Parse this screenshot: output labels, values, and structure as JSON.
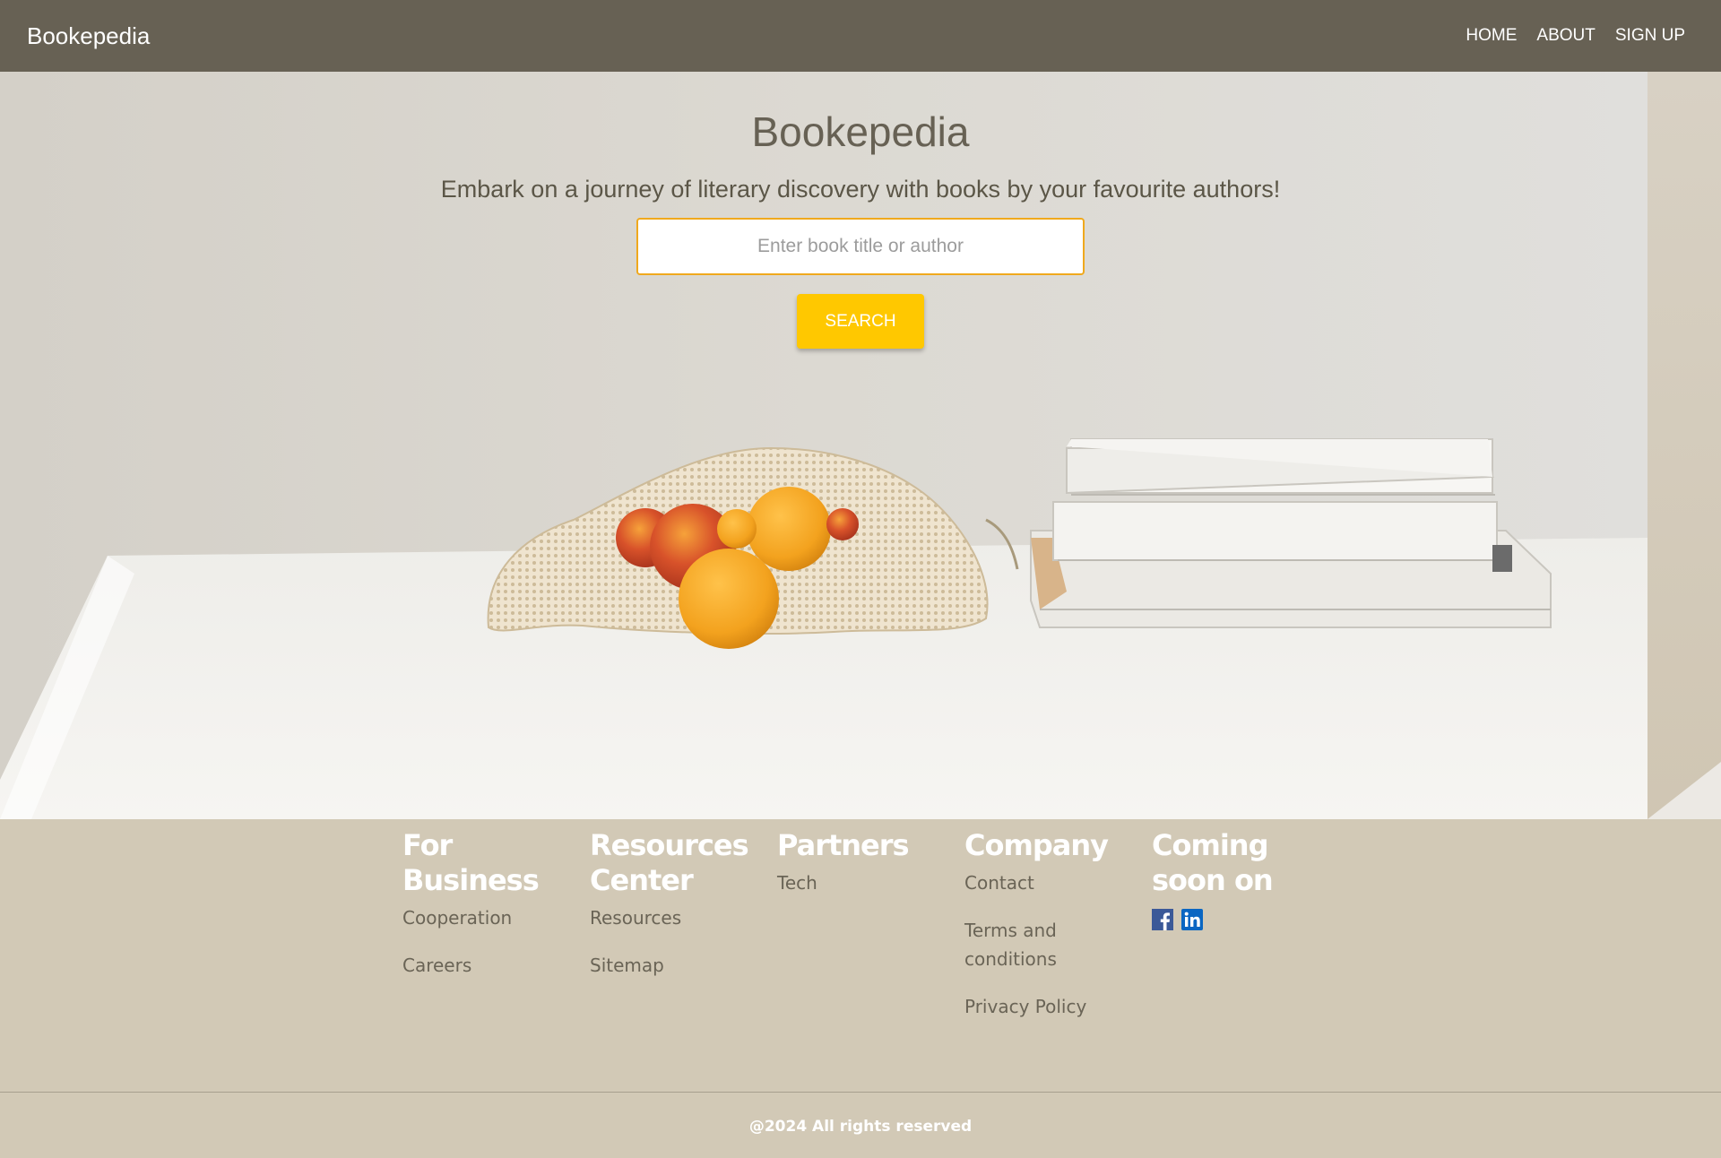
{
  "nav": {
    "brand": "Bookepedia",
    "links": [
      "HOME",
      "ABOUT",
      "SIGN UP"
    ]
  },
  "hero": {
    "title": "Bookepedia",
    "subtitle": "Embark on a journey of literary discovery with books by your favourite authors!",
    "search_placeholder": "Enter book title or author",
    "search_value": "",
    "search_button": "SEARCH"
  },
  "footer": {
    "columns": [
      {
        "heading": "For Business",
        "links": [
          "Cooperation",
          "Careers"
        ]
      },
      {
        "heading": "Resources Center",
        "links": [
          "Resources",
          "Sitemap"
        ]
      },
      {
        "heading": "Partners",
        "links": [
          "Tech"
        ]
      },
      {
        "heading": "Company",
        "links": [
          "Contact",
          "Terms and conditions",
          "Privacy Policy"
        ]
      },
      {
        "heading": "Coming soon on",
        "social": [
          "facebook-icon",
          "linkedin-icon"
        ]
      }
    ],
    "copyright": "@2024 All rights reserved"
  },
  "colors": {
    "navbar": "#676154",
    "footer": "#d2c9b6",
    "accent": "#ffc800",
    "input_border": "#f0a91d",
    "facebook": "#3b5998",
    "linkedin": "#0a66c2"
  }
}
